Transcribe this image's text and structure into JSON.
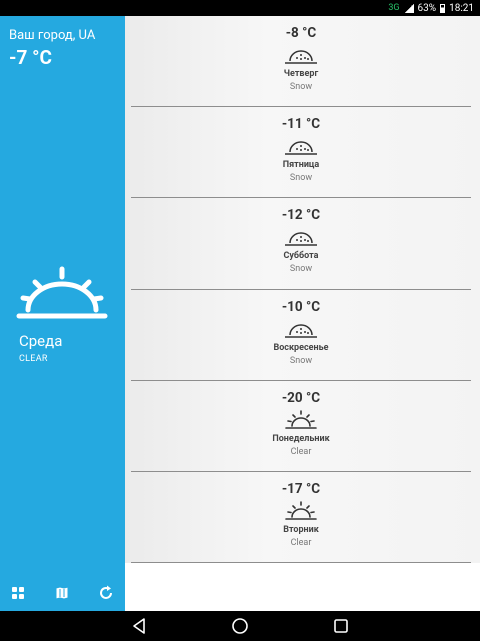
{
  "status": {
    "network": "3G",
    "battery": "63%",
    "time": "18:21"
  },
  "current": {
    "city": "Ваш город, UA",
    "temp": "-7 °C",
    "day": "Среда",
    "condition": "CLEAR",
    "icon": "sun-rising-icon"
  },
  "left_toolbar": [
    {
      "icon": "grid-icon"
    },
    {
      "icon": "map-icon"
    },
    {
      "icon": "refresh-icon"
    }
  ],
  "forecast": [
    {
      "temp": "-8 °C",
      "day": "Четверг",
      "condition": "Snow",
      "icon": "snow-icon"
    },
    {
      "temp": "-11 °C",
      "day": "Пятница",
      "condition": "Snow",
      "icon": "snow-icon"
    },
    {
      "temp": "-12 °C",
      "day": "Суббота",
      "condition": "Snow",
      "icon": "snow-icon"
    },
    {
      "temp": "-10 °C",
      "day": "Воскресенье",
      "condition": "Snow",
      "icon": "snow-icon"
    },
    {
      "temp": "-20 °C",
      "day": "Понедельник",
      "condition": "Clear",
      "icon": "sun-rising-icon"
    },
    {
      "temp": "-17 °C",
      "day": "Вторник",
      "condition": "Clear",
      "icon": "sun-rising-icon"
    }
  ],
  "nav": [
    {
      "icon": "back-icon"
    },
    {
      "icon": "home-icon"
    },
    {
      "icon": "recents-icon"
    }
  ]
}
